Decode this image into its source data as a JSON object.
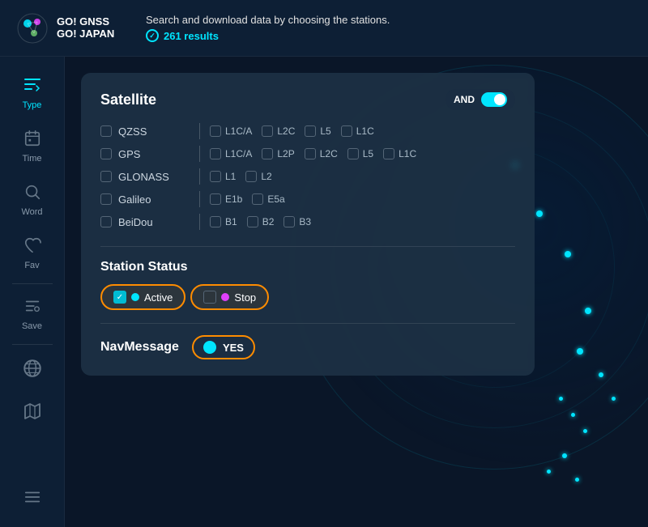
{
  "header": {
    "subtitle": "Search and download data by choosing the stations.",
    "results_count": "261 results",
    "logo_line1": "GO! GNSS",
    "logo_line2": "GO! JAPAN"
  },
  "sidebar": {
    "items": [
      {
        "id": "type",
        "label": "Type",
        "icon": "⚡",
        "active": true
      },
      {
        "id": "time",
        "label": "Time",
        "icon": "📅",
        "active": false
      },
      {
        "id": "word",
        "label": "Word",
        "icon": "🔍",
        "active": false
      },
      {
        "id": "fav",
        "label": "Fav",
        "icon": "♡",
        "active": false
      },
      {
        "id": "save",
        "label": "Save",
        "icon": "⚙",
        "active": false
      },
      {
        "id": "globe",
        "label": "",
        "icon": "🌐",
        "active": false
      },
      {
        "id": "map",
        "label": "",
        "icon": "🗺",
        "active": false
      },
      {
        "id": "list",
        "label": "",
        "icon": "☰",
        "active": false
      }
    ]
  },
  "satellite_section": {
    "title": "Satellite",
    "toggle_label": "AND",
    "rows": [
      {
        "name": "QZSS",
        "options": [
          "L1C/A",
          "L2C",
          "L5",
          "L1C"
        ]
      },
      {
        "name": "GPS",
        "options": [
          "L1C/A",
          "L2P",
          "L2C",
          "L5",
          "L1C"
        ]
      },
      {
        "name": "GLONASS",
        "options": [
          "L1",
          "L2"
        ]
      },
      {
        "name": "Galileo",
        "options": [
          "E1b",
          "E5a"
        ]
      },
      {
        "name": "BeiDou",
        "options": [
          "B1",
          "B2",
          "B3"
        ]
      }
    ]
  },
  "station_status": {
    "title": "Station Status",
    "active_label": "Active",
    "stop_label": "Stop"
  },
  "navmessage": {
    "title": "NavMessage",
    "toggle_label": "YES"
  }
}
